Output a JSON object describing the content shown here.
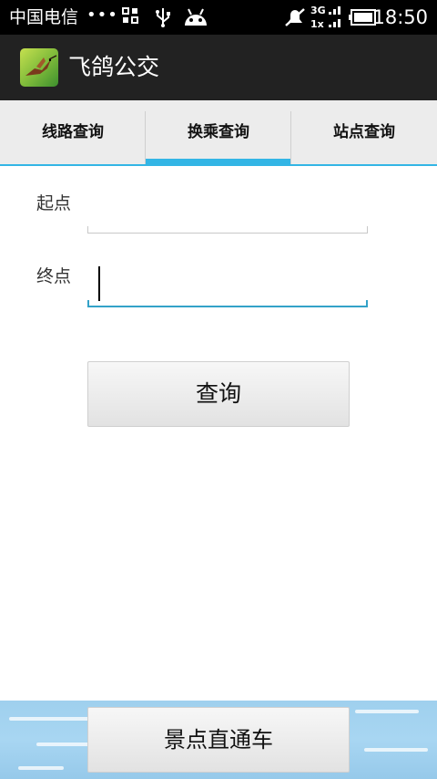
{
  "status_bar": {
    "carrier": "中国电信",
    "dots": "•••",
    "network": "3G",
    "network_alt": "1x",
    "time": "18:50"
  },
  "action_bar": {
    "title": "飞鸽公交",
    "icon": "hummingbird-app-icon"
  },
  "tabs": [
    {
      "label": "线路查询",
      "active": false
    },
    {
      "label": "换乘查询",
      "active": true
    },
    {
      "label": "站点查询",
      "active": false
    }
  ],
  "form": {
    "start_label": "起点",
    "start_value": "",
    "end_label": "终点",
    "end_value": "",
    "query_button": "查询"
  },
  "bottom": {
    "scenic_button": "景点直通车"
  },
  "colors": {
    "accent": "#33b5e5",
    "action_bar": "#222222",
    "status_bar": "#000000",
    "tab_bg": "#ececec",
    "sky": "#a8d6f2"
  }
}
